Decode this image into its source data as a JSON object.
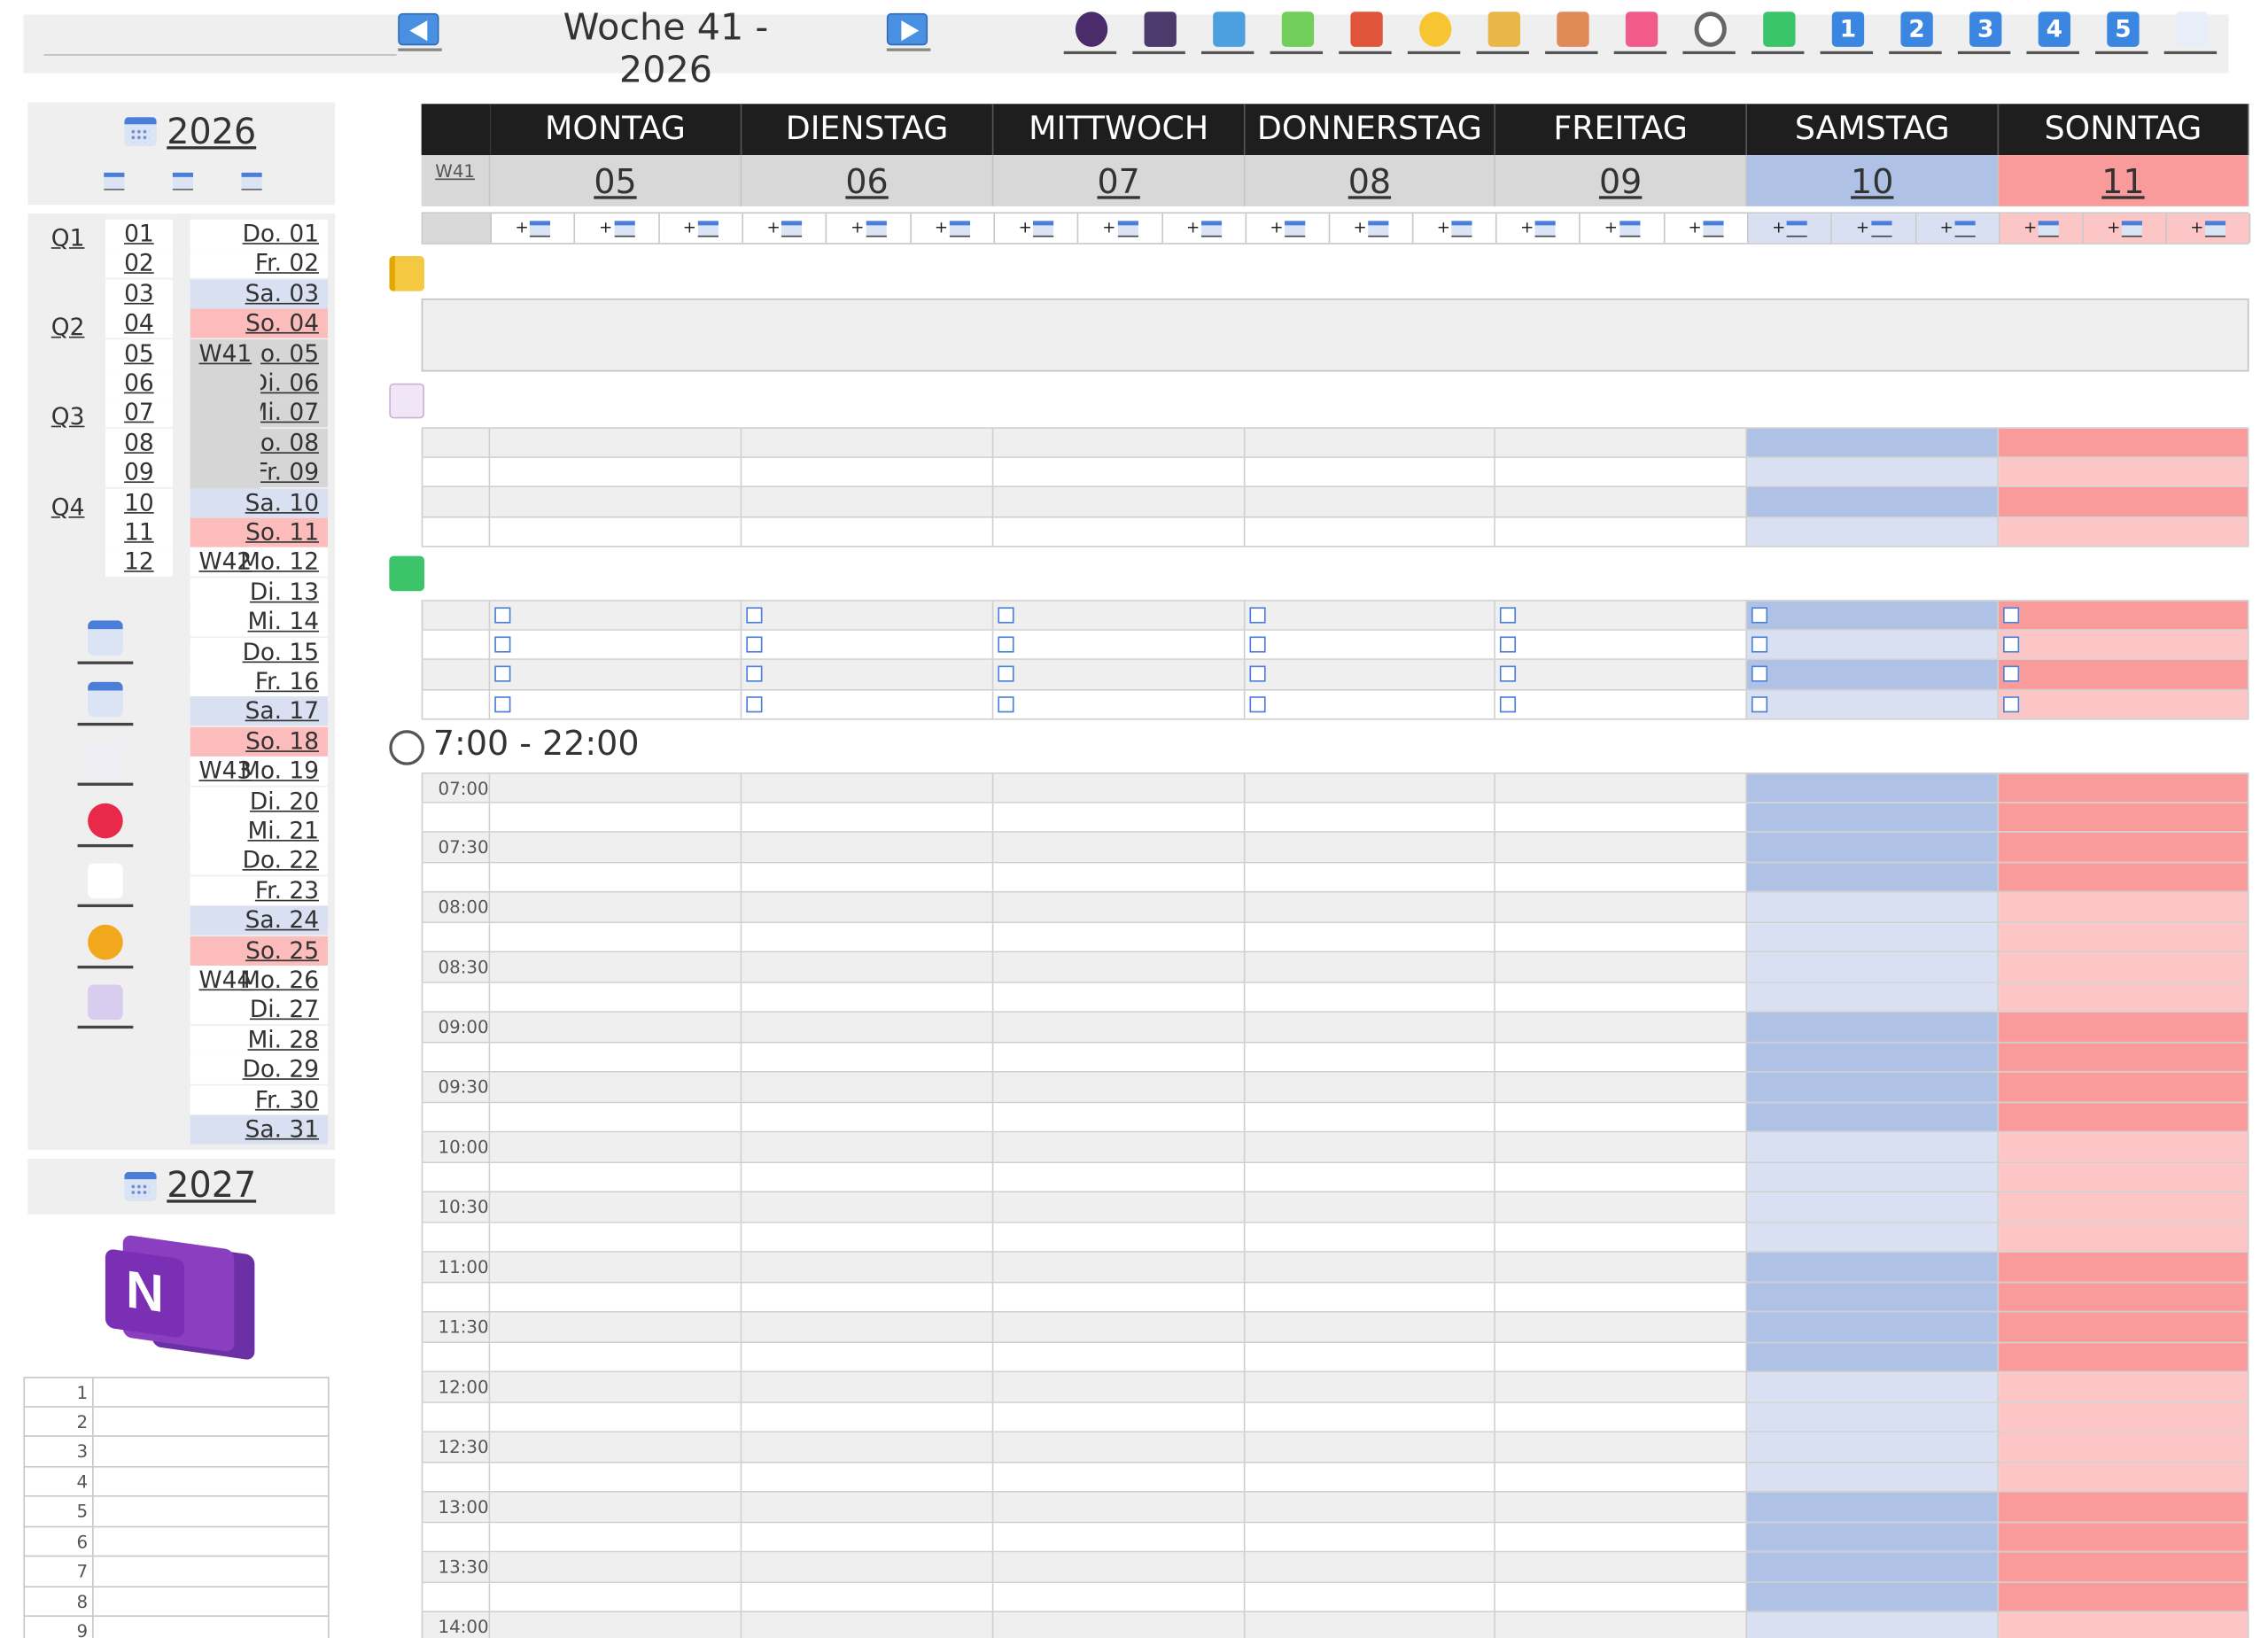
{
  "header": {
    "week_title": "Woche 41 - 2026",
    "toolbar_icons": [
      "person-icon",
      "book-purple-icon",
      "book-blue-icon",
      "book-green-icon",
      "book-red-icon",
      "star-icon",
      "lock-icon",
      "house-icon",
      "backpack-icon",
      "clock-icon",
      "checkmark-icon",
      "number-1-icon",
      "number-2-icon",
      "number-3-icon",
      "number-4-icon",
      "number-5-icon",
      "open-book-icon"
    ],
    "number_buttons": [
      "1",
      "2",
      "3",
      "4",
      "5"
    ]
  },
  "sidebar": {
    "year": "2026",
    "next_year": "2027",
    "quarters": [
      "Q1",
      "Q2",
      "Q3",
      "Q4"
    ],
    "months": [
      "01",
      "02",
      "03",
      "04",
      "05",
      "06",
      "07",
      "08",
      "09",
      "10",
      "11",
      "12"
    ],
    "weeks": [
      "W41",
      "W42",
      "W43",
      "W44"
    ],
    "days": [
      {
        "label": "Do. 01",
        "type": "wd"
      },
      {
        "label": "Fr. 02",
        "type": "wd"
      },
      {
        "label": "Sa. 03",
        "type": "sa"
      },
      {
        "label": "So. 04",
        "type": "so"
      },
      {
        "label": "Mo. 05",
        "type": "cur"
      },
      {
        "label": "Di. 06",
        "type": "cur"
      },
      {
        "label": "Mi. 07",
        "type": "cur"
      },
      {
        "label": "Do. 08",
        "type": "cur"
      },
      {
        "label": "Fr. 09",
        "type": "cur"
      },
      {
        "label": "Sa. 10",
        "type": "sa"
      },
      {
        "label": "So. 11",
        "type": "so"
      },
      {
        "label": "Mo. 12",
        "type": "wd"
      },
      {
        "label": "Di. 13",
        "type": "wd"
      },
      {
        "label": "Mi. 14",
        "type": "wd"
      },
      {
        "label": "Do. 15",
        "type": "wd"
      },
      {
        "label": "Fr. 16",
        "type": "wd"
      },
      {
        "label": "Sa. 17",
        "type": "sa"
      },
      {
        "label": "So. 18",
        "type": "so"
      },
      {
        "label": "Mo. 19",
        "type": "wd"
      },
      {
        "label": "Di. 20",
        "type": "wd"
      },
      {
        "label": "Mi. 21",
        "type": "wd"
      },
      {
        "label": "Do. 22",
        "type": "wd"
      },
      {
        "label": "Fr. 23",
        "type": "wd"
      },
      {
        "label": "Sa. 24",
        "type": "sa"
      },
      {
        "label": "So. 25",
        "type": "so"
      },
      {
        "label": "Mo. 26",
        "type": "wd"
      },
      {
        "label": "Di. 27",
        "type": "wd"
      },
      {
        "label": "Mi. 28",
        "type": "wd"
      },
      {
        "label": "Do. 29",
        "type": "wd"
      },
      {
        "label": "Fr. 30",
        "type": "wd"
      },
      {
        "label": "Sa. 31",
        "type": "sa"
      }
    ],
    "side_icons": [
      "calendar-month-icon",
      "calendar-year-icon",
      "note-pencil-icon",
      "heart-icon",
      "running-person-icon",
      "coin-icon",
      "notepad-icon"
    ],
    "number_list": [
      "1",
      "2",
      "3",
      "4",
      "5",
      "6",
      "7",
      "8",
      "9"
    ]
  },
  "week": {
    "label": "W41",
    "days": [
      {
        "name": "MONTAG",
        "date": "05",
        "type": "wd"
      },
      {
        "name": "DIENSTAG",
        "date": "06",
        "type": "wd"
      },
      {
        "name": "MITTWOCH",
        "date": "07",
        "type": "wd"
      },
      {
        "name": "DONNERSTAG",
        "date": "08",
        "type": "wd"
      },
      {
        "name": "FREITAG",
        "date": "09",
        "type": "wd"
      },
      {
        "name": "SAMSTAG",
        "date": "10",
        "type": "sa"
      },
      {
        "name": "SONNTAG",
        "date": "11",
        "type": "so"
      }
    ],
    "add_button_label": "+"
  },
  "schedule": {
    "title": "7:00 - 22:00",
    "times": [
      "07:00",
      "07:30",
      "08:00",
      "08:30",
      "09:00",
      "09:30",
      "10:00",
      "10:30",
      "11:00",
      "11:30",
      "12:00",
      "12:30",
      "13:00",
      "13:30",
      "14:00"
    ]
  },
  "colors": {
    "weekend_sa_dark": "#afc2e6",
    "weekend_sa_light": "#d9e0f2",
    "weekend_so_dark": "#fa9b9b",
    "weekend_so_light": "#fdc6c6",
    "header_dark": "#1e1e1e",
    "accent_blue": "#4a7ed8"
  }
}
